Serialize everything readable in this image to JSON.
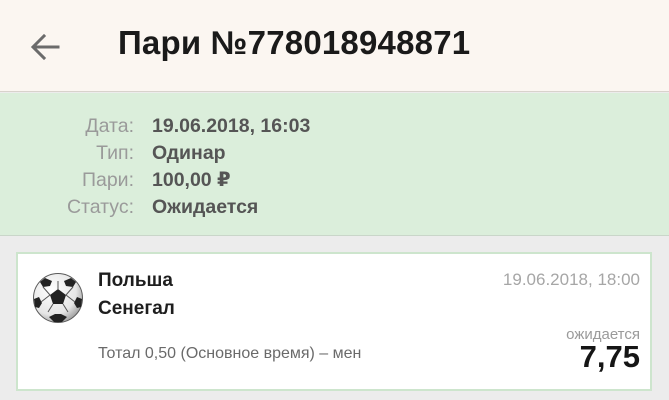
{
  "header": {
    "back_icon": "arrow-left-icon",
    "title": "Пари №778018948871"
  },
  "info": {
    "rows": [
      {
        "label": "Дата:",
        "value": "19.06.2018, 16:03"
      },
      {
        "label": "Тип:",
        "value": "Одинар"
      },
      {
        "label": "Пари:",
        "value": "100,00 ₽"
      },
      {
        "label": "Статус:",
        "value": "Ожидается"
      }
    ]
  },
  "bet": {
    "sport_icon": "soccer-ball-icon",
    "team1": "Польша",
    "team2": "Сенегал",
    "match_datetime": "19.06.2018, 18:00",
    "market": "Тотал 0,50 (Основное время) – мен",
    "status": "ожидается",
    "odds": "7,75"
  },
  "colors": {
    "header_bg": "#fbf6f1",
    "info_bg": "#dbeedb",
    "card_border": "#cde5cd",
    "background": "#ececec"
  }
}
